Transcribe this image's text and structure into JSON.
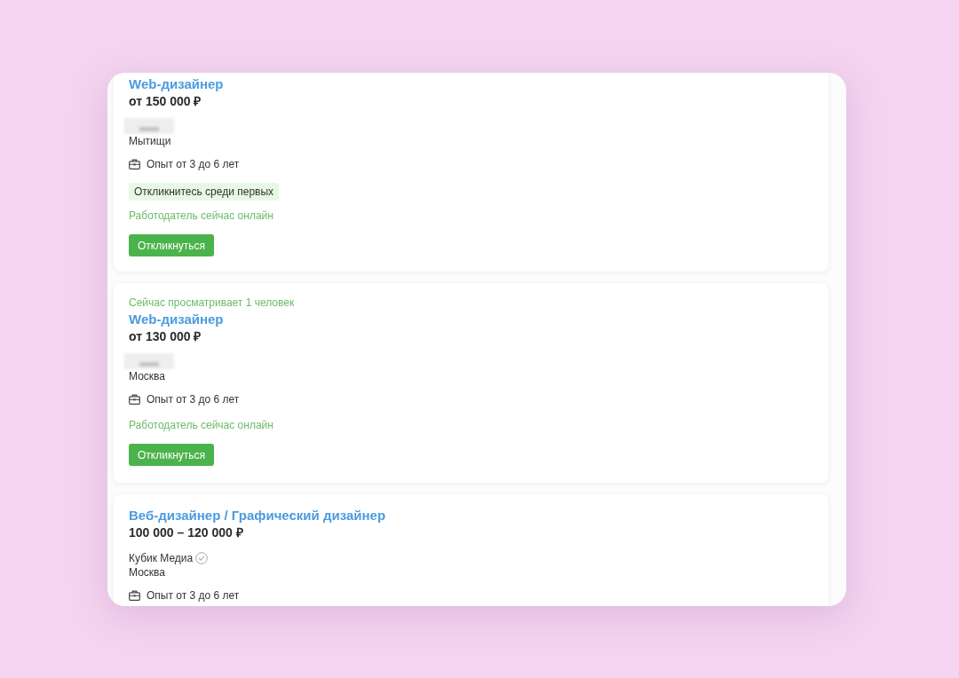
{
  "vacancies": [
    {
      "title": "Web-дизайнер",
      "salary": "от 150 000 ₽",
      "company_hidden": true,
      "city": "Мытищи",
      "experience": "Опыт от 3 до 6 лет",
      "badge": "Откликнитесь среди первых",
      "employer_online": "Работодатель сейчас онлайн",
      "button": "Откликнуться"
    },
    {
      "viewers": "Сейчас просматривает 1 человек",
      "title": "Web-дизайнер",
      "salary": "от 130 000 ₽",
      "company_hidden": true,
      "city": "Москва",
      "experience": "Опыт от 3 до 6 лет",
      "employer_online": "Работодатель сейчас онлайн",
      "button": "Откликнуться"
    },
    {
      "title": "Веб-дизайнер / Графический дизайнер",
      "salary": "100 000 – 120 000 ₽",
      "company": "Кубик Медиа",
      "company_verified": true,
      "city": "Москва",
      "experience": "Опыт от 3 до 6 лет"
    }
  ]
}
